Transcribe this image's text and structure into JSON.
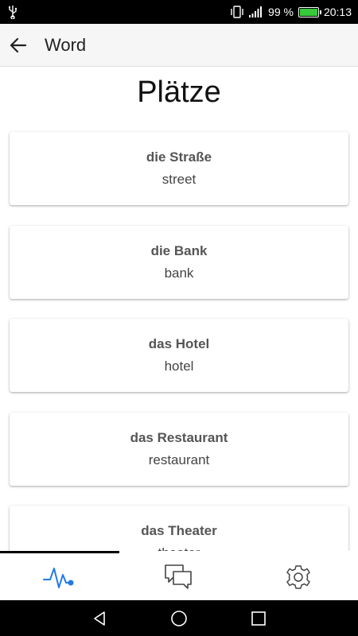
{
  "status_bar": {
    "battery_percent_text": "99 %",
    "time": "20:13",
    "battery_level": 0.99,
    "battery_color": "#36c93a"
  },
  "app_bar": {
    "title": "Word"
  },
  "page": {
    "title": "Plätze",
    "words": [
      {
        "term": "die Straße",
        "translation": "street"
      },
      {
        "term": "die Bank",
        "translation": "bank"
      },
      {
        "term": "das Hotel",
        "translation": "hotel"
      },
      {
        "term": "das Restaurant",
        "translation": "restaurant"
      },
      {
        "term": "das Theater",
        "translation": "theater"
      }
    ]
  },
  "bottom_tabs": {
    "active_color": "#1e7be6",
    "inactive_color": "#444444",
    "tabs": [
      {
        "icon": "activity-icon",
        "active": true
      },
      {
        "icon": "chat-icon",
        "active": false
      },
      {
        "icon": "settings-icon",
        "active": false
      }
    ]
  }
}
